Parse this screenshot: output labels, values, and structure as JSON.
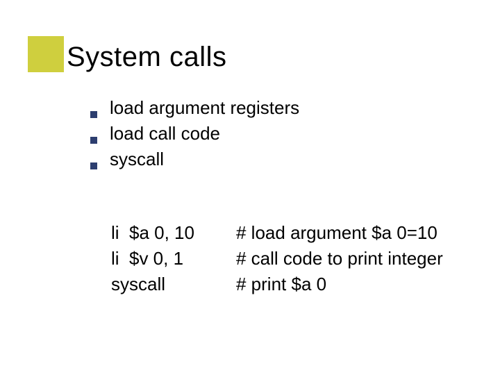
{
  "title": "System calls",
  "bullets": [
    "load argument registers",
    "load call code",
    "syscall"
  ],
  "code": {
    "rows": [
      {
        "inst": "li  $a 0, 10",
        "comment": "# load argument $a 0=10"
      },
      {
        "inst": "li  $v 0, 1",
        "comment": "# call code to print integer"
      },
      {
        "inst": "syscall",
        "comment": "# print $a 0"
      }
    ]
  }
}
